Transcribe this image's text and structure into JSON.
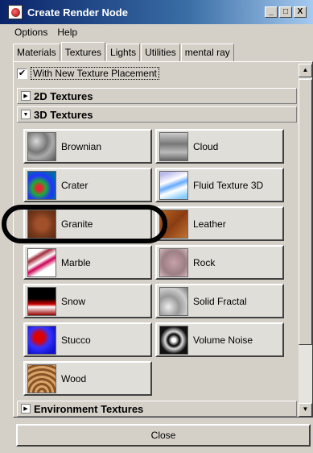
{
  "window": {
    "title": "Create Render Node",
    "controls": [
      "_",
      "□",
      "X"
    ]
  },
  "menu": [
    "Options",
    "Help"
  ],
  "tabs": [
    {
      "label": "Materials"
    },
    {
      "label": "Textures"
    },
    {
      "label": "Lights"
    },
    {
      "label": "Utilities"
    },
    {
      "label": "mental ray"
    }
  ],
  "checkbox": {
    "label": "With New Texture Placement",
    "checked": "✔"
  },
  "sections": {
    "two_d": "2D Textures",
    "three_d": "3D Textures",
    "env": "Environment Textures"
  },
  "textures": [
    {
      "label": "Brownian",
      "icon": "brownian-thumbnail"
    },
    {
      "label": "Cloud",
      "icon": "cloud-thumbnail"
    },
    {
      "label": "Crater",
      "icon": "crater-thumbnail"
    },
    {
      "label": "Fluid Texture 3D",
      "icon": "fluid-texture-3d-thumbnail"
    },
    {
      "label": "Granite",
      "icon": "granite-thumbnail"
    },
    {
      "label": "Leather",
      "icon": "leather-thumbnail"
    },
    {
      "label": "Marble",
      "icon": "marble-thumbnail"
    },
    {
      "label": "Rock",
      "icon": "rock-thumbnail"
    },
    {
      "label": "Snow",
      "icon": "snow-thumbnail"
    },
    {
      "label": "Solid Fractal",
      "icon": "solid-fractal-thumbnail"
    },
    {
      "label": "Stucco",
      "icon": "stucco-thumbnail"
    },
    {
      "label": "Volume Noise",
      "icon": "volume-noise-thumbnail"
    },
    {
      "label": "Wood",
      "icon": "wood-thumbnail"
    }
  ],
  "close_label": "Close"
}
